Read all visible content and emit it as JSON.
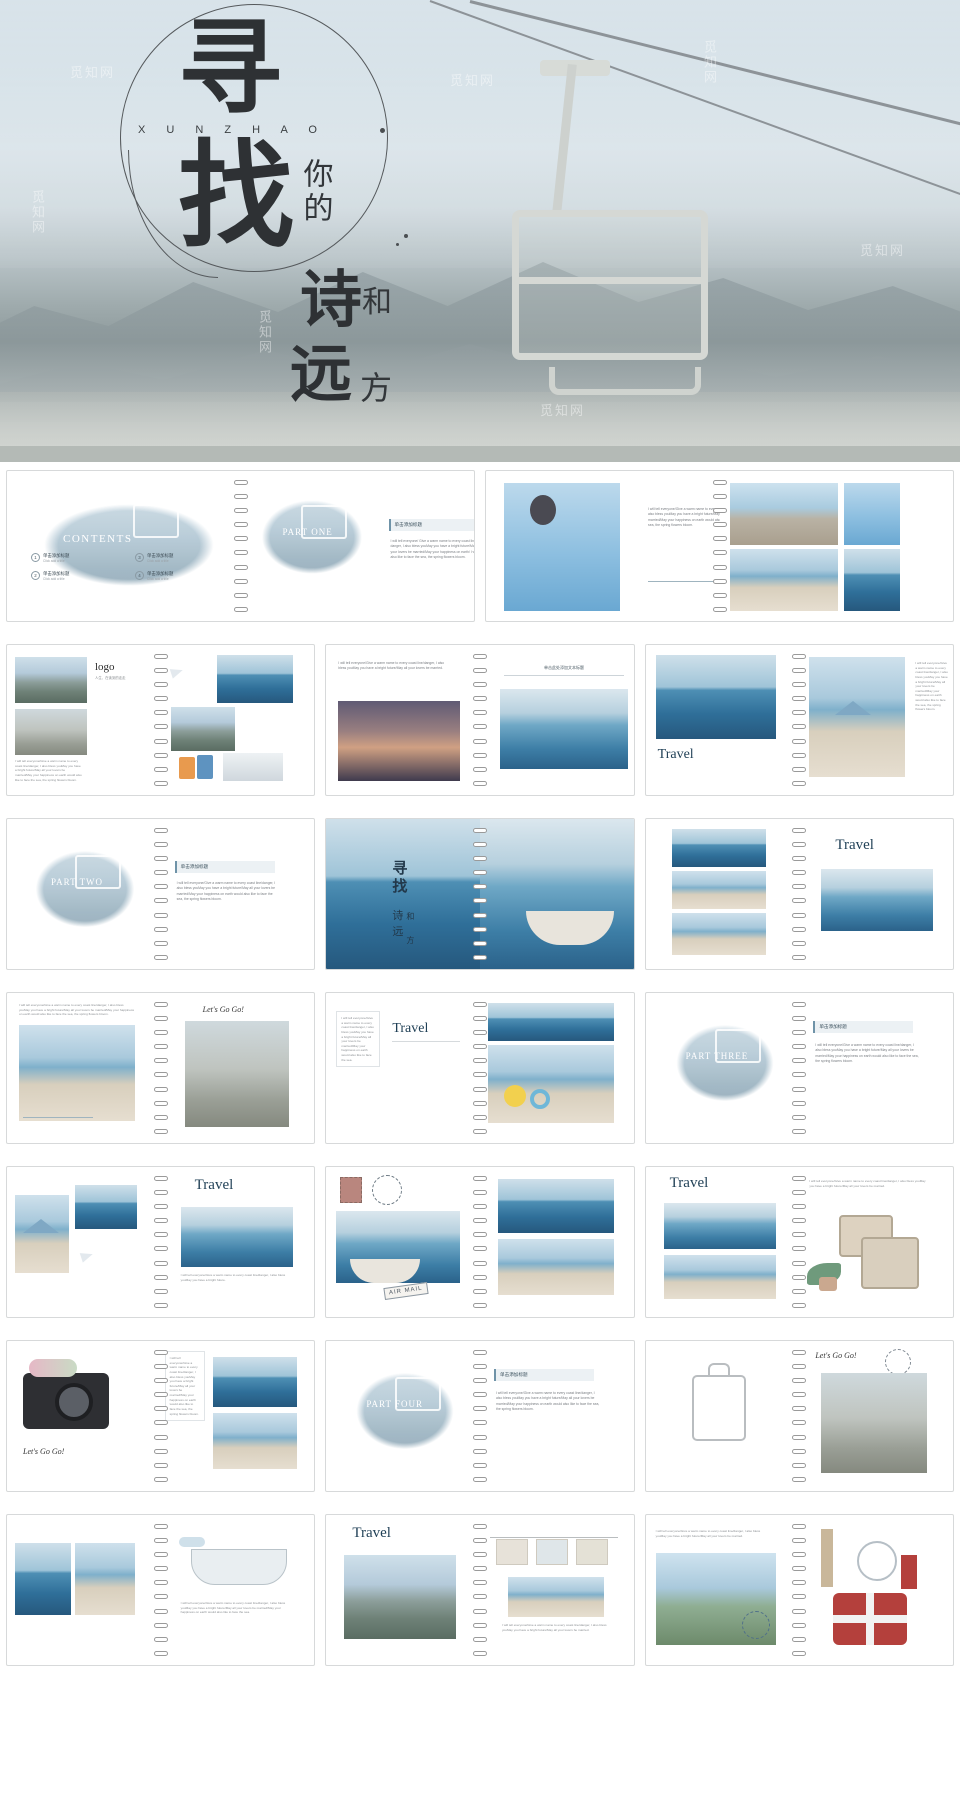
{
  "document": {
    "type": "powerpoint-template-preview",
    "watermark_text": "觅知网"
  },
  "hero": {
    "title_line1": "寻",
    "title_line2": "找",
    "pinyin": "X U N  Z H A O",
    "subtitle_vertical": "你的",
    "poem_char1": "诗",
    "poem_char2": "和",
    "poem_char3": "远",
    "poem_char4": "方",
    "image_alt": "chairlift-over-mountains"
  },
  "slides": [
    {
      "id": 1,
      "name": "contents-slide",
      "title": "CONTENTS",
      "items": [
        {
          "num": "1",
          "label": "单击添加标题",
          "sub": "Click  add  a  title"
        },
        {
          "num": "2",
          "label": "单击添加标题",
          "sub": "Click  add  a  title"
        },
        {
          "num": "3",
          "label": "单击添加标题",
          "sub": "Click  add  a  title"
        },
        {
          "num": "4",
          "label": "单击添加标题",
          "sub": "Click  add  a  title"
        }
      ]
    },
    {
      "id": 2,
      "name": "part-one-slide",
      "part_label": "PART ONE",
      "heading": "单击添加标题",
      "body": "I will tell everyone/ Give a warm name to every coast line/ danger, I also bless youMay you have a bright future/May all your lovers be married/May your happiness on earth/ I would also like to face the sea, the spring flowers bloom."
    },
    {
      "id": 3,
      "name": "photo-collage-slide",
      "body": "I will tell everyone/Give a warm name to every coast line/danger, I also bless youMay you have a bright future/May all your lovers be married/May your happiness on earth would also like to face the sea, the spring flowers bloom.",
      "images": [
        "hot-air-balloon",
        "coastal-town",
        "balloons-sky",
        "seaside-village"
      ]
    },
    {
      "id": 4,
      "name": "logo-slide",
      "logo_label": "logo",
      "logo_sub": "人生，在读到的走走",
      "body": "I will tell everyone/Give a warm name to every coast line/danger, I also bless youMay you have a bright future/May all your lovers be married/May your happiness on earth would also like to face the sea, the spring flowers bloom."
    },
    {
      "id": 5,
      "name": "sunset-pier-slide",
      "body": "I will tell everyone/Give a warm name to every coast line/danger, I also bless youMay you have a bright future/May all your lovers be married.",
      "heading": "单击此处添加文本标题",
      "image_alt": "pier-over-sea"
    },
    {
      "id": 6,
      "name": "travel-bench-slide",
      "title": "Travel",
      "body": "I will tell everyone/Give a warm name to every coast line/danger, I also bless youMay you have a bright future/May all your lovers be married/May your happiness on earth would also like to face the sea, the spring flowers bloom."
    },
    {
      "id": 7,
      "name": "part-two-slide",
      "part_label": "PART TWO",
      "heading": "单击添加标题",
      "body": "I will tell everyone/Give a warm name to every coast line/danger, I also bless youMay you have a bright future/May all your lovers be married/May your happiness on earth would also like to face the sea, the spring flowers bloom."
    },
    {
      "id": 8,
      "name": "xunzhao-boat-slide",
      "char1": "寻",
      "char2": "找",
      "char3": "诗",
      "char4": "和",
      "char5": "远",
      "char6": "方",
      "image_alt": "boat-on-calm-sea"
    },
    {
      "id": 9,
      "name": "travel-beach-grid-slide",
      "title": "Travel",
      "images": [
        "beach-sea",
        "pebble-beach",
        "person-on-beach"
      ]
    },
    {
      "id": 10,
      "name": "lets-go-go-slide",
      "script_text": "Let's Go Go!",
      "body": "I will tell everyone/Give a warm name to every coast line/danger, I also bless youMay you have a bright future/May all your lovers be married/May your happiness on earth would also like to face the sea, the spring flowers bloom."
    },
    {
      "id": 11,
      "name": "travel-float-ring-slide",
      "title": "Travel",
      "body": "I will tell everyone/Give a warm name to every coast line/danger, I also bless youMay you have a bright future/May all your lovers be married/May your happiness on earth would also like to face the sea.",
      "image_alt": "pebble-beach-with-duck-float"
    },
    {
      "id": 12,
      "name": "part-three-slide",
      "part_label": "PART THREE",
      "heading": "单击添加标题",
      "body": "I will tell everyone/Give a warm name to every coast line/danger, I also bless youMay you have a bright future/May all your lovers be married/May your happiness on earth would also like to face the sea, the spring flowers bloom."
    },
    {
      "id": 13,
      "name": "travel-umbrella-slide",
      "title": "Travel",
      "body": "I will tell everyone/Give a warm name to every coast line/danger, I also bless youMay you have a bright future."
    },
    {
      "id": 14,
      "name": "air-mail-slide",
      "stamp_label": "AIR MAIL",
      "image_alt": "boat-on-sea"
    },
    {
      "id": 15,
      "name": "travel-suitcase-slide",
      "title": "Travel",
      "body": "I will tell everyone/Give a warm name to every coast line/danger, I also bless youMay you have a bright future/May all your lovers be married."
    },
    {
      "id": 16,
      "name": "camera-slide",
      "script_text": "Let's Go Go!",
      "body": "I will tell everyone/Give a warm name to every coast line/danger, I also bless youMay you have a bright future/May all your lovers be married/May your happiness on earth would also like to face the sea, the spring flowers bloom."
    },
    {
      "id": 17,
      "name": "part-four-slide",
      "part_label": "PART FOUR",
      "heading": "单击添加标题",
      "body": "I will tell everyone/Give a warm name to every coast line/danger, I also bless youMay you have a bright future/May all your lovers be married/May your happiness on earth would also like to face the sea, the spring flowers bloom."
    },
    {
      "id": 18,
      "name": "luggage-bicycle-slide",
      "script_text": "Let's Go Go!",
      "image_alt": "bicycle-by-building"
    },
    {
      "id": 19,
      "name": "cruise-ship-slide",
      "body": "I will tell everyone/Give a warm name to every coast line/danger, I also bless youMay you have a bright future/May all your lovers be married/May your happiness on earth would also like to face the sea.",
      "image_alt": "cruise-ship-illustration"
    },
    {
      "id": 20,
      "name": "travel-polaroid-slide",
      "title": "Travel",
      "body": "I will tell everyone/Give a warm name to every coast line/danger, I also bless youMay you have a bright future/May all your lovers be married.",
      "image_alt": "hanging-photos"
    },
    {
      "id": 21,
      "name": "london-slide",
      "body": "I will tell everyone/Give a warm name to every coast line/danger, I also bless youMay you have a bright future/May all your lovers be married.",
      "image_alt": "london-suitcase-big-ben"
    }
  ],
  "colors": {
    "accent_blue": "#1f3f55",
    "brush_blue": "#9fb6c3",
    "panel_bg": "#ecf1f4",
    "text_gray": "#7b7f84"
  }
}
